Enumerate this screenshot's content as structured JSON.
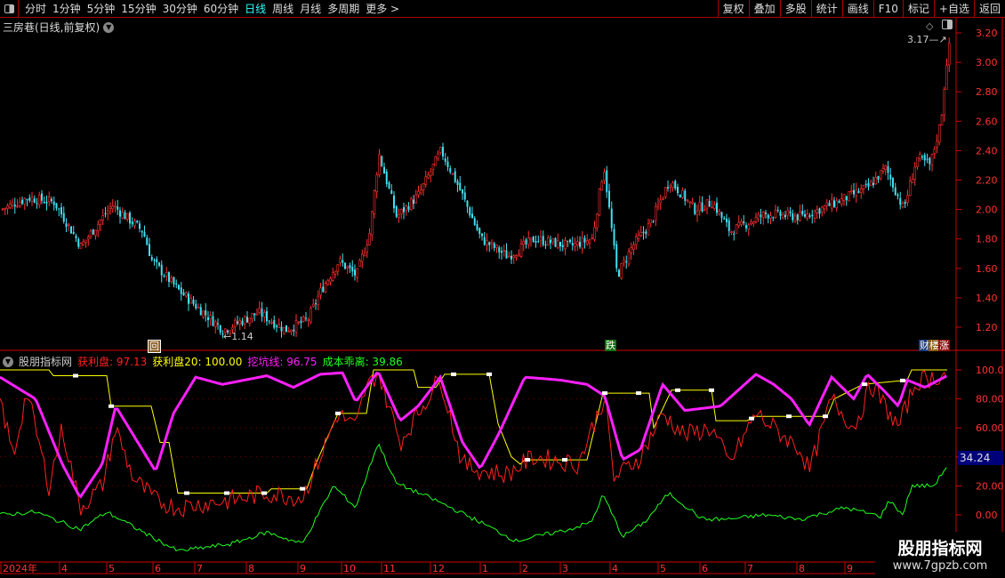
{
  "toolbar": {
    "periods": [
      "分时",
      "1分钟",
      "5分钟",
      "15分钟",
      "30分钟",
      "60分钟",
      "日线",
      "周线",
      "月线",
      "多周期",
      "更多 >"
    ],
    "active": "日线",
    "right_buttons": [
      "复权",
      "叠加",
      "多股",
      "统计",
      "画线",
      "F10",
      "标记",
      "+自选",
      "返回"
    ]
  },
  "stock_title": "三房巷(日线,前复权)",
  "indicator": {
    "name": "股朋指标网",
    "items": [
      {
        "label": "获利盘: 97.13",
        "color": "#ff2020"
      },
      {
        "label": "获利盘20: 100.00",
        "color": "#ffff00"
      },
      {
        "label": "挖坑线: 96.75",
        "color": "#ff20ff"
      },
      {
        "label": "成本乖离: 39.86",
        "color": "#20ff20"
      }
    ],
    "current_value": "34.24"
  },
  "markers": {
    "low": "1.14",
    "high": "3.17",
    "m1": "回",
    "m2": "跌",
    "m3": [
      "财",
      "楼",
      "涨"
    ]
  },
  "watermark": {
    "name": "股朋指标网",
    "url": "www.7gpzb.com"
  },
  "chart_data": [
    {
      "type": "candlestick",
      "title": "三房巷 日线",
      "ylim": [
        1.1,
        3.25
      ],
      "yticks": [
        "3.20",
        "3.00",
        "2.80",
        "2.60",
        "2.40",
        "2.20",
        "2.00",
        "1.80",
        "1.60",
        "1.40",
        "1.20"
      ],
      "x_labels": [
        "2024年",
        "4",
        "5",
        "6",
        "7",
        "8",
        "9",
        "10",
        "11",
        "12",
        "1",
        "2",
        "3",
        "4",
        "5",
        "6",
        "7",
        "8",
        "9"
      ],
      "close_path": [
        [
          0,
          2.0
        ],
        [
          30,
          2.08
        ],
        [
          60,
          2.05
        ],
        [
          90,
          1.75
        ],
        [
          125,
          2.03
        ],
        [
          160,
          1.85
        ],
        [
          170,
          1.65
        ],
        [
          200,
          1.45
        ],
        [
          250,
          1.18
        ],
        [
          290,
          1.3
        ],
        [
          320,
          1.18
        ],
        [
          345,
          1.25
        ],
        [
          360,
          1.45
        ],
        [
          380,
          1.65
        ],
        [
          400,
          1.55
        ],
        [
          415,
          1.85
        ],
        [
          425,
          2.38
        ],
        [
          445,
          1.95
        ],
        [
          470,
          2.1
        ],
        [
          495,
          2.4
        ],
        [
          515,
          2.15
        ],
        [
          540,
          1.8
        ],
        [
          570,
          1.68
        ],
        [
          600,
          1.8
        ],
        [
          640,
          1.75
        ],
        [
          665,
          1.8
        ],
        [
          678,
          2.3
        ],
        [
          693,
          1.55
        ],
        [
          710,
          1.75
        ],
        [
          730,
          1.9
        ],
        [
          752,
          2.2
        ],
        [
          780,
          2.0
        ],
        [
          800,
          2.05
        ],
        [
          820,
          1.85
        ],
        [
          860,
          1.97
        ],
        [
          900,
          1.95
        ],
        [
          940,
          2.05
        ],
        [
          975,
          2.15
        ],
        [
          995,
          2.28
        ],
        [
          1015,
          2.0
        ],
        [
          1030,
          2.35
        ],
        [
          1045,
          2.3
        ],
        [
          1057,
          2.6
        ],
        [
          1065,
          3.1
        ]
      ]
    },
    {
      "type": "line",
      "title": "股朋指标网",
      "ylim": [
        -30,
        105
      ],
      "yticks": [
        "100.0",
        "80.00",
        "60.00",
        "40.00",
        "20.00",
        "0.00"
      ],
      "series": [
        {
          "name": "获利盘20",
          "color": "#ffff00",
          "points": [
            [
              0,
              100
            ],
            [
              55,
              100
            ],
            [
              60,
              96
            ],
            [
              120,
              96
            ],
            [
              125,
              75
            ],
            [
              170,
              75
            ],
            [
              180,
              50
            ],
            [
              190,
              50
            ],
            [
              200,
              15
            ],
            [
              300,
              15
            ],
            [
              305,
              18
            ],
            [
              345,
              18
            ],
            [
              355,
              35
            ],
            [
              380,
              70
            ],
            [
              412,
              70
            ],
            [
              420,
              100
            ],
            [
              465,
              100
            ],
            [
              470,
              88
            ],
            [
              490,
              88
            ],
            [
              500,
              97
            ],
            [
              550,
              97
            ],
            [
              560,
              63
            ],
            [
              575,
              40
            ],
            [
              585,
              35
            ],
            [
              590,
              38
            ],
            [
              660,
              38
            ],
            [
              678,
              84
            ],
            [
              730,
              84
            ],
            [
              735,
              60
            ],
            [
              755,
              86
            ],
            [
              800,
              86
            ],
            [
              805,
              65
            ],
            [
              840,
              65
            ],
            [
              850,
              68
            ],
            [
              930,
              68
            ],
            [
              938,
              80
            ],
            [
              970,
              90
            ],
            [
              1020,
              93
            ],
            [
              1025,
              100
            ],
            [
              1065,
              100
            ]
          ]
        },
        {
          "name": "获利盘",
          "color": "#ff2020",
          "points": [
            [
              0,
              80
            ],
            [
              15,
              40
            ],
            [
              30,
              85
            ],
            [
              55,
              20
            ],
            [
              70,
              60
            ],
            [
              90,
              5
            ],
            [
              115,
              20
            ],
            [
              130,
              60
            ],
            [
              150,
              25
            ],
            [
              175,
              10
            ],
            [
              200,
              5
            ],
            [
              230,
              8
            ],
            [
              260,
              10
            ],
            [
              300,
              15
            ],
            [
              340,
              12
            ],
            [
              360,
              40
            ],
            [
              380,
              70
            ],
            [
              400,
              60
            ],
            [
              410,
              85
            ],
            [
              425,
              99
            ],
            [
              450,
              50
            ],
            [
              470,
              70
            ],
            [
              495,
              95
            ],
            [
              520,
              35
            ],
            [
              545,
              30
            ],
            [
              570,
              28
            ],
            [
              600,
              40
            ],
            [
              650,
              35
            ],
            [
              680,
              82
            ],
            [
              690,
              25
            ],
            [
              720,
              40
            ],
            [
              745,
              70
            ],
            [
              770,
              55
            ],
            [
              800,
              60
            ],
            [
              820,
              35
            ],
            [
              850,
              70
            ],
            [
              870,
              60
            ],
            [
              900,
              45
            ],
            [
              910,
              30
            ],
            [
              935,
              80
            ],
            [
              960,
              60
            ],
            [
              980,
              90
            ],
            [
              1010,
              60
            ],
            [
              1030,
              92
            ],
            [
              1065,
              97
            ]
          ]
        },
        {
          "name": "挖坑线",
          "color": "#ff20ff",
          "points": [
            [
              0,
              95
            ],
            [
              40,
              80
            ],
            [
              70,
              35
            ],
            [
              90,
              12
            ],
            [
              115,
              35
            ],
            [
              130,
              75
            ],
            [
              150,
              55
            ],
            [
              175,
              30
            ],
            [
              195,
              70
            ],
            [
              220,
              95
            ],
            [
              250,
              90
            ],
            [
              300,
              96
            ],
            [
              330,
              88
            ],
            [
              360,
              97
            ],
            [
              385,
              98
            ],
            [
              400,
              78
            ],
            [
              425,
              99
            ],
            [
              450,
              65
            ],
            [
              470,
              75
            ],
            [
              495,
              95
            ],
            [
              520,
              50
            ],
            [
              540,
              32
            ],
            [
              560,
              55
            ],
            [
              590,
              95
            ],
            [
              630,
              93
            ],
            [
              660,
              90
            ],
            [
              680,
              82
            ],
            [
              700,
              38
            ],
            [
              720,
              45
            ],
            [
              745,
              90
            ],
            [
              770,
              72
            ],
            [
              810,
              75
            ],
            [
              850,
              97
            ],
            [
              870,
              90
            ],
            [
              890,
              80
            ],
            [
              910,
              62
            ],
            [
              935,
              95
            ],
            [
              960,
              80
            ],
            [
              975,
              97
            ],
            [
              995,
              85
            ],
            [
              1010,
              75
            ],
            [
              1020,
              93
            ],
            [
              1040,
              88
            ],
            [
              1065,
              96
            ]
          ]
        },
        {
          "name": "成本乖离",
          "color": "#20ff20",
          "points": [
            [
              0,
              0
            ],
            [
              40,
              2
            ],
            [
              90,
              -10
            ],
            [
              120,
              2
            ],
            [
              170,
              -15
            ],
            [
              200,
              -25
            ],
            [
              260,
              -20
            ],
            [
              300,
              -12
            ],
            [
              340,
              -20
            ],
            [
              375,
              20
            ],
            [
              400,
              5
            ],
            [
              425,
              50
            ],
            [
              445,
              22
            ],
            [
              490,
              10
            ],
            [
              540,
              -5
            ],
            [
              580,
              -18
            ],
            [
              640,
              -10
            ],
            [
              665,
              -5
            ],
            [
              678,
              14
            ],
            [
              700,
              -15
            ],
            [
              725,
              -5
            ],
            [
              752,
              15
            ],
            [
              790,
              -3
            ],
            [
              820,
              -3
            ],
            [
              860,
              0
            ],
            [
              900,
              -3
            ],
            [
              950,
              5
            ],
            [
              990,
              -1
            ],
            [
              1000,
              10
            ],
            [
              1015,
              0
            ],
            [
              1025,
              20
            ],
            [
              1050,
              20
            ],
            [
              1065,
              34
            ]
          ]
        }
      ]
    }
  ]
}
